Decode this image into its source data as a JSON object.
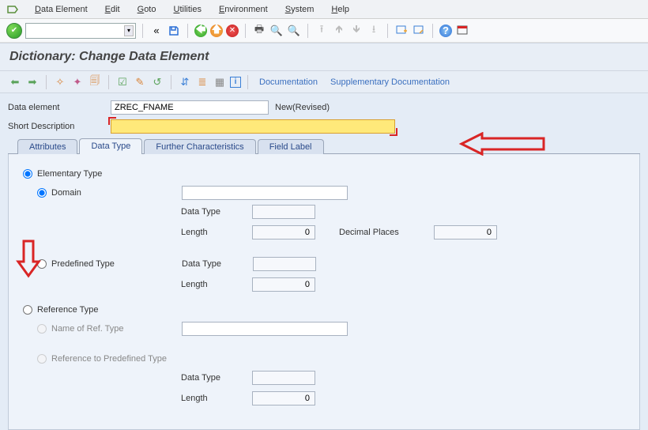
{
  "menu": {
    "items": [
      "Data Element",
      "Edit",
      "Goto",
      "Utilities",
      "Environment",
      "System",
      "Help"
    ]
  },
  "page": {
    "title": "Dictionary: Change Data Element"
  },
  "appbar": {
    "doc": "Documentation",
    "suppdoc": "Supplementary Documentation"
  },
  "form": {
    "label_element": "Data element",
    "value_element": "ZREC_FNAME",
    "status": "New(Revised)",
    "label_desc": "Short Description",
    "value_desc": ""
  },
  "tabs": {
    "t1": "Attributes",
    "t2": "Data Type",
    "t3": "Further Characteristics",
    "t4": "Field Label"
  },
  "dt": {
    "elem_type": "Elementary Type",
    "domain": "Domain",
    "domain_value": "",
    "data_type": "Data Type",
    "length": "Length",
    "decimal": "Decimal Places",
    "len_val": "0",
    "dec_val": "0",
    "predef": "Predefined Type",
    "pre_len_val": "0",
    "ref_type": "Reference Type",
    "ref_name": "Name of Ref. Type",
    "ref_predef": "Reference to Predefined Type",
    "ref_len_val": "0"
  }
}
